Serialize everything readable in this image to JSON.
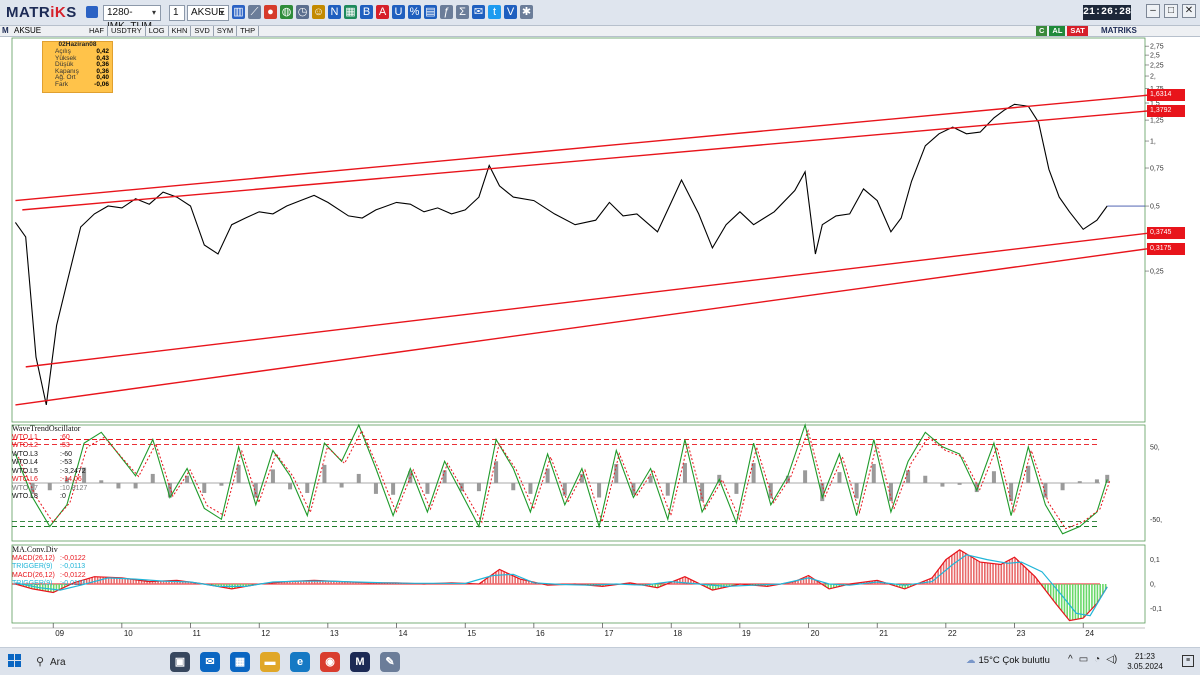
{
  "app": {
    "logo_main": "MATR",
    "logo_accent": "iK",
    "logo_tail": "S",
    "clock": "21:26:28"
  },
  "toolbar": {
    "layout_field": "1280-IMK_TUM",
    "period_field": "1",
    "symbol_field": "AKSUE",
    "icons": [
      {
        "name": "bar-chart-icon",
        "glyph": "▥",
        "color": "#2b62c4"
      },
      {
        "name": "line-chart-icon",
        "glyph": "⟋",
        "color": "#6b7d99"
      },
      {
        "name": "color-palette-icon",
        "glyph": "●",
        "color": "#d63b2b"
      },
      {
        "name": "globe-icon",
        "glyph": "◍",
        "color": "#2e8c3a"
      },
      {
        "name": "clock-icon",
        "glyph": "◷",
        "color": "#5b6f8f"
      },
      {
        "name": "smiley-icon",
        "glyph": "☺",
        "color": "#c38a00"
      },
      {
        "name": "news-icon",
        "glyph": "N",
        "color": "#1f5fbf"
      },
      {
        "name": "table-icon",
        "glyph": "▦",
        "color": "#1f8a5c"
      },
      {
        "name": "bold-b-icon",
        "glyph": "B",
        "color": "#1f5fbf"
      },
      {
        "name": "text-a-icon",
        "glyph": "A",
        "color": "#d6202a"
      },
      {
        "name": "underline-u-icon",
        "glyph": "U",
        "color": "#1f5fbf"
      },
      {
        "name": "percent-icon",
        "glyph": "%",
        "color": "#1f5fbf"
      },
      {
        "name": "volume-icon",
        "glyph": "▤",
        "color": "#1f5fbf"
      },
      {
        "name": "function-icon",
        "glyph": "ƒ",
        "color": "#6b7d99"
      },
      {
        "name": "formula-icon",
        "glyph": "Σ",
        "color": "#6b7d99"
      },
      {
        "name": "email-icon",
        "glyph": "✉",
        "color": "#1f5fbf"
      },
      {
        "name": "twitter-icon",
        "glyph": "t",
        "color": "#1d9bf0"
      },
      {
        "name": "v-icon",
        "glyph": "V",
        "color": "#1f5fbf"
      },
      {
        "name": "settings-icon",
        "glyph": "✱",
        "color": "#6b7d99"
      }
    ]
  },
  "chartbar": {
    "symbol": "AKSUE",
    "tabs": [
      "HAF",
      "USDTRY",
      "LOG",
      "KHN",
      "SVD",
      "SYM",
      "THP"
    ],
    "buttons": [
      {
        "label": "C",
        "color": "#3a8a3a"
      },
      {
        "label": "AL",
        "color": "#1f8a3a"
      },
      {
        "label": "SAT",
        "color": "#d6202a"
      }
    ],
    "logo": "MATRIKS"
  },
  "infobox": {
    "date": "02Haziran08",
    "rows": [
      {
        "label": "Açılış",
        "value": "0,42"
      },
      {
        "label": "Yüksek",
        "value": "0,43"
      },
      {
        "label": "Düşük",
        "value": "0,36"
      },
      {
        "label": "Kapanış",
        "value": "0,36"
      },
      {
        "label": "Ağ. Ort",
        "value": "0,40"
      },
      {
        "label": "Fark",
        "value": "-0,06"
      }
    ]
  },
  "price_labels": [
    "1,6314",
    "1,3792",
    "0,3745",
    "0,3175"
  ],
  "oscillator": {
    "title": "WaveTrendOscillator",
    "rows": [
      {
        "name": "WTO.L1",
        "value": "60",
        "color": "#e8141b"
      },
      {
        "name": "WTO.L2",
        "value": "53",
        "color": "#e8141b"
      },
      {
        "name": "WTO.L3",
        "value": "-60",
        "color": "#111111"
      },
      {
        "name": "WTO.L4",
        "value": "-53",
        "color": "#111111"
      },
      {
        "name": "WTO.L5",
        "value": "-3,2472",
        "color": "#111111"
      },
      {
        "name": "WTO.L6",
        "value": "-14,06",
        "color": "#e8141b"
      },
      {
        "name": "WTO.L7",
        "value": "10,8127",
        "color": "#777777"
      },
      {
        "name": "WTO.L8",
        "value": "0",
        "color": "#111111"
      }
    ]
  },
  "macd": {
    "title": "MA.Conv.Div",
    "rows": [
      {
        "name": "MACD(26,12)",
        "value": "-0,0122",
        "color": "#e8141b"
      },
      {
        "name": "TRIGGER(9)",
        "value": "-0,0113",
        "color": "#20b5d8"
      },
      {
        "name": "MACD(26,12)",
        "value": "-0,0122",
        "color": "#e8141b"
      },
      {
        "name": "TRIGGER(9)",
        "value": "-0,0113",
        "color": "#20b5d8"
      }
    ]
  },
  "chart_data": {
    "type": "line",
    "title": "",
    "scale": "log",
    "price_axis_ticks": [
      "2,75",
      "2,5",
      "2,25",
      "2,",
      "1,75",
      "1,5",
      "1,25",
      "1,",
      "0,75",
      "0,5",
      "0,25"
    ],
    "osc_axis_ticks": [
      "50,",
      "-50,"
    ],
    "macd_axis_ticks": [
      "0,1",
      "0,",
      "-0,1"
    ],
    "x_ticks": [
      "09",
      "10",
      "11",
      "12",
      "13",
      "14",
      "15",
      "16",
      "17",
      "18",
      "19",
      "20",
      "21",
      "22",
      "23",
      "24"
    ],
    "price_series": {
      "name": "AKSUE",
      "x": [
        2008.45,
        2008.6,
        2008.75,
        2008.9,
        2009.05,
        2009.2,
        2009.4,
        2009.6,
        2009.8,
        2010.0,
        2010.2,
        2010.4,
        2010.6,
        2010.8,
        2011.0,
        2011.2,
        2011.4,
        2011.6,
        2011.8,
        2012.0,
        2012.2,
        2012.4,
        2012.6,
        2012.8,
        2013.0,
        2013.3,
        2013.5,
        2013.7,
        2014.0,
        2014.2,
        2014.4,
        2014.6,
        2014.8,
        2015.0,
        2015.2,
        2015.35,
        2015.5,
        2015.7,
        2016.0,
        2016.3,
        2016.6,
        2016.9,
        2017.1,
        2017.3,
        2017.5,
        2017.8,
        2018.0,
        2018.15,
        2018.4,
        2018.6,
        2018.8,
        2019.0,
        2019.2,
        2019.5,
        2019.8,
        2019.95,
        2020.1,
        2020.2,
        2020.4,
        2020.6,
        2020.8,
        2021.0,
        2021.2,
        2021.35,
        2021.5,
        2021.7,
        2021.9,
        2022.1,
        2022.3,
        2022.5,
        2022.7,
        2022.85,
        2023.0,
        2023.2,
        2023.35,
        2023.5,
        2023.65,
        2023.8,
        2024.0,
        2024.2,
        2024.35
      ],
      "y": [
        0.42,
        0.36,
        0.1,
        0.06,
        0.14,
        0.22,
        0.4,
        0.46,
        0.5,
        0.49,
        0.54,
        0.51,
        0.58,
        0.55,
        0.5,
        0.33,
        0.3,
        0.41,
        0.44,
        0.47,
        0.46,
        0.5,
        0.53,
        0.56,
        0.52,
        0.45,
        0.44,
        0.48,
        0.52,
        0.51,
        0.47,
        0.49,
        0.46,
        0.48,
        0.55,
        0.77,
        0.62,
        0.55,
        0.53,
        0.46,
        0.41,
        0.43,
        0.52,
        0.45,
        0.46,
        0.38,
        0.52,
        0.66,
        0.46,
        0.32,
        0.41,
        0.47,
        0.41,
        0.47,
        0.59,
        0.72,
        0.3,
        0.41,
        0.45,
        0.46,
        0.6,
        0.53,
        0.38,
        0.44,
        0.65,
        0.95,
        1.08,
        1.16,
        1.08,
        1.1,
        1.28,
        1.39,
        1.48,
        1.45,
        1.22,
        0.74,
        0.55,
        0.47,
        0.39,
        0.43,
        0.5
      ]
    },
    "channel_lines": [
      {
        "name": "upper-channel-outer",
        "x": [
          2008.45,
          2024.95
        ],
        "y": [
          0.53,
          1.6314
        ]
      },
      {
        "name": "upper-channel-inner",
        "x": [
          2008.55,
          2024.95
        ],
        "y": [
          0.48,
          1.3792
        ]
      },
      {
        "name": "lower-channel-inner",
        "x": [
          2008.6,
          2024.95
        ],
        "y": [
          0.09,
          0.3745
        ]
      },
      {
        "name": "lower-channel-outer",
        "x": [
          2008.45,
          2024.95
        ],
        "y": [
          0.06,
          0.3175
        ]
      }
    ],
    "osc_levels": {
      "upper": [
        60,
        53
      ],
      "lower": [
        -60,
        -53
      ]
    },
    "osc_series": {
      "name": "WTO",
      "x": [
        2008.45,
        2008.7,
        2008.95,
        2009.2,
        2009.45,
        2009.7,
        2009.95,
        2010.2,
        2010.45,
        2010.7,
        2010.95,
        2011.2,
        2011.45,
        2011.7,
        2011.95,
        2012.2,
        2012.45,
        2012.7,
        2012.95,
        2013.2,
        2013.45,
        2013.7,
        2013.95,
        2014.2,
        2014.45,
        2014.7,
        2014.95,
        2015.2,
        2015.45,
        2015.7,
        2015.95,
        2016.2,
        2016.45,
        2016.7,
        2016.95,
        2017.2,
        2017.45,
        2017.7,
        2017.95,
        2018.2,
        2018.45,
        2018.7,
        2018.95,
        2019.2,
        2019.45,
        2019.7,
        2019.95,
        2020.2,
        2020.45,
        2020.7,
        2020.95,
        2021.2,
        2021.45,
        2021.7,
        2021.95,
        2022.2,
        2022.45,
        2022.7,
        2022.95,
        2023.2,
        2023.45,
        2023.7,
        2023.95,
        2024.2,
        2024.35
      ],
      "y": [
        40,
        -20,
        -60,
        -30,
        55,
        70,
        40,
        10,
        60,
        -20,
        20,
        -35,
        -50,
        50,
        -30,
        45,
        10,
        -45,
        55,
        30,
        80,
        20,
        -45,
        20,
        -40,
        30,
        -15,
        -60,
        60,
        20,
        -40,
        40,
        -30,
        20,
        -60,
        45,
        -20,
        20,
        -50,
        60,
        -40,
        5,
        -55,
        55,
        -30,
        10,
        80,
        -20,
        40,
        -45,
        60,
        -40,
        30,
        70,
        50,
        40,
        -10,
        55,
        -45,
        50,
        -30,
        -70,
        -60,
        -40,
        5
      ]
    },
    "macd_series": {
      "name": "MACD(26,12)",
      "x": [
        2008.45,
        2008.7,
        2009.0,
        2009.3,
        2009.6,
        2010.0,
        2010.4,
        2010.8,
        2011.2,
        2011.6,
        2012.0,
        2012.4,
        2012.8,
        2013.2,
        2013.6,
        2014.0,
        2014.4,
        2014.8,
        2015.2,
        2015.5,
        2015.8,
        2016.2,
        2016.6,
        2017.0,
        2017.4,
        2017.8,
        2018.2,
        2018.6,
        2019.0,
        2019.4,
        2019.8,
        2020.0,
        2020.3,
        2020.6,
        2021.0,
        2021.4,
        2021.8,
        2022.0,
        2022.2,
        2022.5,
        2022.8,
        2023.0,
        2023.3,
        2023.6,
        2023.8,
        2024.0,
        2024.2,
        2024.35
      ],
      "y": [
        0.0,
        -0.02,
        -0.035,
        0.005,
        0.03,
        0.025,
        0.01,
        0.015,
        0.0,
        -0.02,
        0.0,
        0.01,
        0.015,
        0.01,
        0.005,
        0.005,
        0.0,
        0.005,
        0.0,
        0.06,
        0.02,
        -0.005,
        0.0,
        -0.01,
        0.005,
        -0.015,
        0.03,
        -0.025,
        0.0,
        -0.01,
        0.01,
        0.035,
        -0.02,
        0.0,
        0.015,
        -0.02,
        0.025,
        0.1,
        0.14,
        0.09,
        0.08,
        0.11,
        0.03,
        -0.08,
        -0.15,
        -0.14,
        -0.08,
        -0.0122
      ]
    },
    "trigger_series": {
      "name": "TRIGGER(9)",
      "x": [
        2008.45,
        2008.8,
        2009.1,
        2009.4,
        2009.8,
        2010.2,
        2010.6,
        2011.0,
        2011.4,
        2011.8,
        2012.2,
        2012.6,
        2013.0,
        2013.4,
        2013.8,
        2014.2,
        2014.6,
        2015.0,
        2015.4,
        2015.7,
        2016.0,
        2016.4,
        2016.8,
        2017.2,
        2017.6,
        2018.0,
        2018.4,
        2018.8,
        2019.2,
        2019.6,
        2020.0,
        2020.3,
        2020.6,
        2021.0,
        2021.4,
        2021.8,
        2022.1,
        2022.3,
        2022.6,
        2022.9,
        2023.1,
        2023.4,
        2023.7,
        2023.9,
        2024.1,
        2024.35
      ],
      "y": [
        0.005,
        -0.015,
        -0.025,
        -0.005,
        0.025,
        0.02,
        0.012,
        0.008,
        -0.01,
        -0.01,
        0.008,
        0.012,
        0.012,
        0.008,
        0.005,
        0.003,
        0.003,
        0.002,
        0.035,
        0.04,
        0.005,
        -0.002,
        -0.005,
        0.0,
        -0.005,
        0.01,
        0.0,
        -0.01,
        -0.005,
        0.0,
        0.025,
        0.0,
        -0.005,
        0.008,
        -0.005,
        0.01,
        0.08,
        0.12,
        0.1,
        0.085,
        0.09,
        0.05,
        -0.05,
        -0.12,
        -0.13,
        -0.0113
      ]
    }
  },
  "taskbar": {
    "search_label": "Ara",
    "apps": [
      {
        "name": "task-view-icon",
        "glyph": "▣",
        "color": "#37475e"
      },
      {
        "name": "mail-icon",
        "glyph": "✉",
        "color": "#0a66c2"
      },
      {
        "name": "store-icon",
        "glyph": "▦",
        "color": "#0a66c2"
      },
      {
        "name": "file-explorer-icon",
        "glyph": "▬",
        "color": "#e0a728"
      },
      {
        "name": "edge-icon",
        "glyph": "e",
        "color": "#1579c4"
      },
      {
        "name": "chrome-icon",
        "glyph": "◉",
        "color": "#d93d2e"
      },
      {
        "name": "matriks-app-icon",
        "glyph": "M",
        "color": "#1c2a55"
      },
      {
        "name": "paint-icon",
        "glyph": "✎",
        "color": "#6b7d99"
      }
    ],
    "weather": "15°C  Çok bulutlu",
    "time": "21:23",
    "date": "3.05.2024"
  }
}
